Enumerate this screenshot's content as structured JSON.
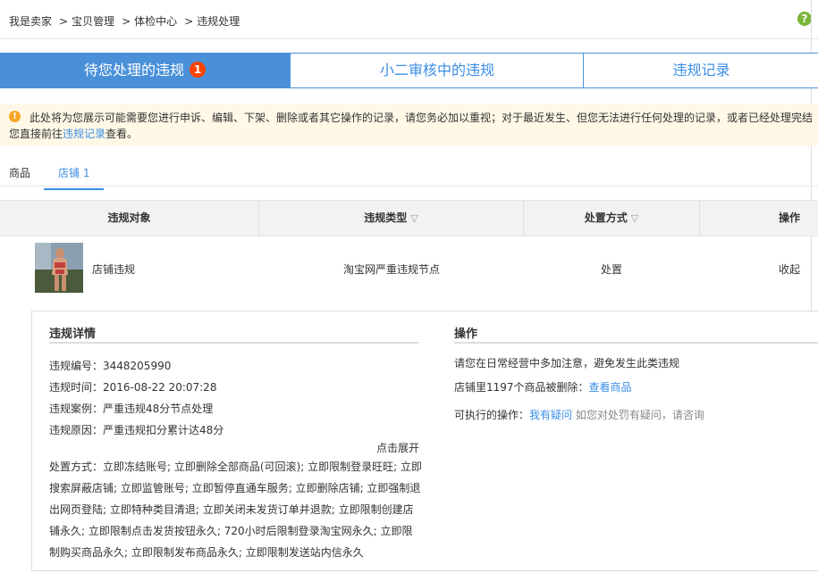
{
  "breadcrumb": [
    "我是卖家",
    "宝贝管理",
    "体检中心",
    "违规处理"
  ],
  "breadcrumb_sep": ">",
  "help_icon_glyph": "?",
  "tabs": [
    {
      "label": "待您处理的违规",
      "badge": "1"
    },
    {
      "label": "小二审核中的违规"
    },
    {
      "label": "违规记录"
    }
  ],
  "notice": {
    "line1": "此处将为您展示可能需要您进行申诉、编辑、下架、删除或者其它操作的记录，请您务必加以重视；对于最近发生、但您无法进行任何处理的记录，或者已经处理完结",
    "line2_pre": "您直接前往",
    "line2_link": "违规记录",
    "line2_post": "查看。"
  },
  "subtabs": [
    "商品",
    "店铺 1"
  ],
  "table": {
    "headers": [
      "违规对象",
      "违规类型",
      "处置方式",
      "操作"
    ],
    "row": {
      "object": "店铺违规",
      "type": "淘宝网严重违规节点",
      "action": "处置",
      "op": "收起"
    }
  },
  "detail": {
    "title": "违规详情",
    "id_line": "违规编号：3448205990",
    "time_line": "违规时间：2016-08-22 20:07:28",
    "case_line": "违规案例：严重违规48分节点处理",
    "reason_line": "违规原因：严重违规扣分累计达48分",
    "expand": "点击展开",
    "handling": "处置方式：立即冻结账号; 立即删除全部商品(可回滚); 立即限制登录旺旺; 立即搜索屏蔽店铺; 立即监管账号; 立即暂停直通车服务; 立即删除店铺; 立即强制退出网页登陆; 立即特种类目清退; 立即关闭未发货订单并退款; 立即限制创建店铺永久; 立即限制点击发货按钮永久; 720小时后限制登录淘宝网永久; 立即限制购买商品永久; 立即限制发布商品永久; 立即限制发送站内信永久"
  },
  "ops": {
    "title": "操作",
    "line1": "请您在日常经营中多加注意，避免发生此类违规",
    "line2_pre": "店铺里1197个商品被删除：",
    "line2_link": "查看商品",
    "line3_pre": "可执行的操作：",
    "line3_link": "我有疑问",
    "line3_hint": "如您对处罚有疑问，请咨询"
  },
  "colors": {
    "accent": "#4a90d9",
    "badge": "#ff4400",
    "link": "#3a8ee6",
    "notice_bg": "#fff8e7"
  }
}
